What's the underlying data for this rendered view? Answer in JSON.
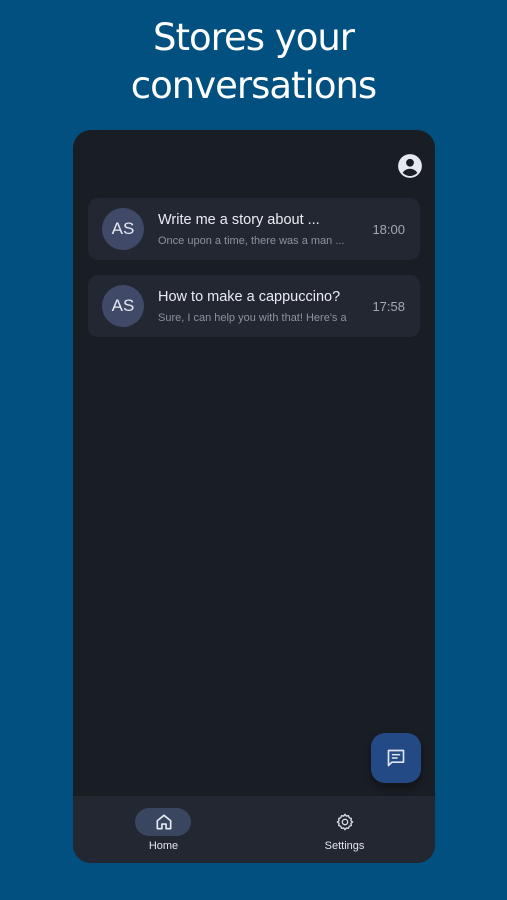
{
  "headline": {
    "line1": "Stores your",
    "line2": "conversations"
  },
  "colors": {
    "background": "#02507f",
    "app_background": "#191d24",
    "card": "#232731",
    "avatar": "#404a68",
    "fab": "#244a86",
    "nav_active_pill": "#3a4560"
  },
  "header": {
    "profile_icon": "account-circle-icon"
  },
  "conversations": [
    {
      "avatar": "AS",
      "title": "Write me a story about ...",
      "preview": "Once upon a time, there was a man ...",
      "time": "18:00"
    },
    {
      "avatar": "AS",
      "title": "How to make a cappuccino?",
      "preview": "Sure, I can help you with that! Here's a ...",
      "time": "17:58"
    }
  ],
  "fab": {
    "icon": "new-chat-icon"
  },
  "bottom_nav": {
    "items": [
      {
        "label": "Home",
        "icon": "home-icon",
        "active": true
      },
      {
        "label": "Settings",
        "icon": "gear-icon",
        "active": false
      }
    ]
  }
}
